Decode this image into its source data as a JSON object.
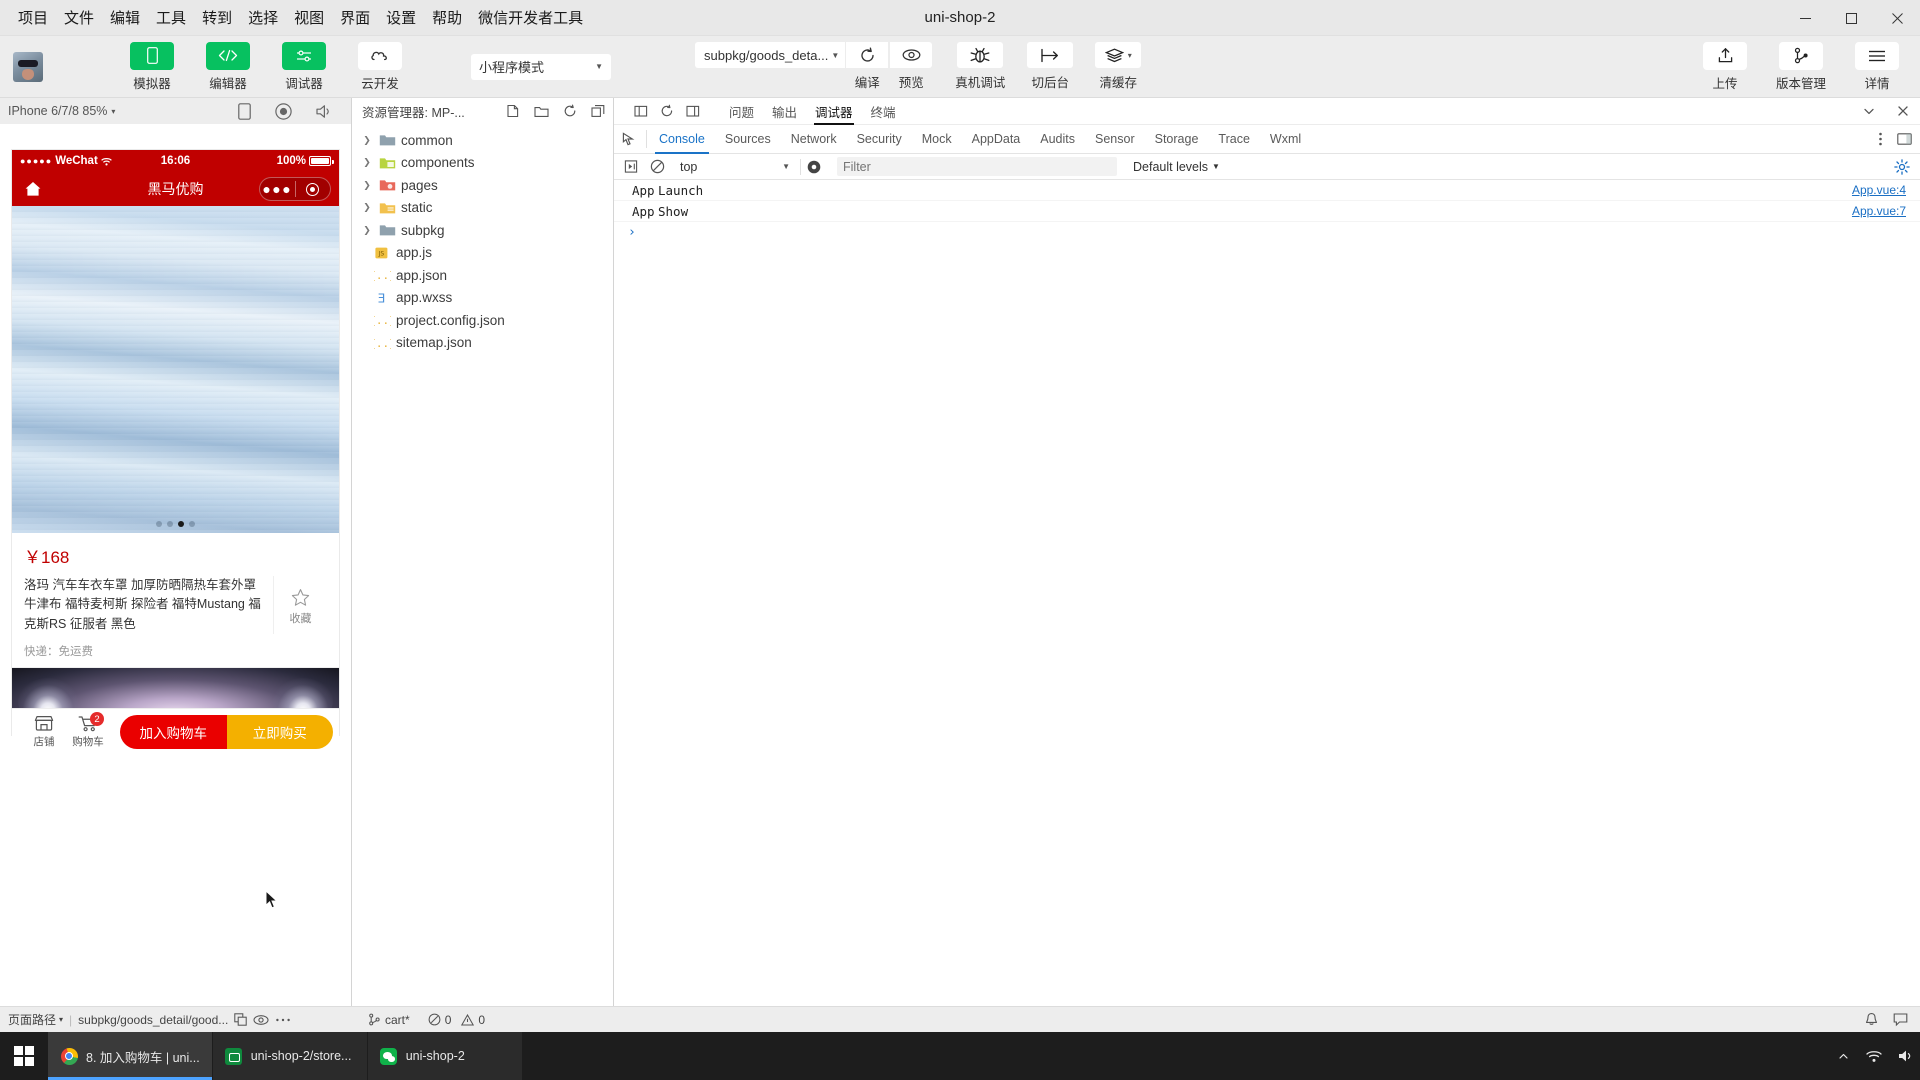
{
  "window": {
    "title": "uni-shop-2",
    "menus": [
      "项目",
      "文件",
      "编辑",
      "工具",
      "转到",
      "选择",
      "视图",
      "界面",
      "设置",
      "帮助",
      "微信开发者工具"
    ],
    "controls": {
      "minimize": "—",
      "maximize": "□",
      "close": "✕"
    }
  },
  "toolbar": {
    "avatar_name": "avatar",
    "main_buttons": [
      {
        "label": "模拟器",
        "icon": "phone-icon",
        "style": "green"
      },
      {
        "label": "编辑器",
        "icon": "code-icon",
        "style": "green"
      },
      {
        "label": "调试器",
        "icon": "debug-sliders-icon",
        "style": "green"
      },
      {
        "label": "云开发",
        "icon": "cloud-icon",
        "style": "white"
      }
    ],
    "mode_select": {
      "value": "小程序模式",
      "caret": "▼"
    },
    "page_select": {
      "value": "subpkg/goods_deta...",
      "caret": "▼"
    },
    "compile_label": "编译",
    "preview_label": "预览",
    "compile_icon": "refresh-icon",
    "preview_icon": "eye-icon",
    "real_debug": {
      "label": "真机调试",
      "icon": "bug-icon"
    },
    "background": {
      "label": "切后台",
      "icon": "background-arrow-icon"
    },
    "clear_cache": {
      "label": "清缓存",
      "icon": "layers-icon",
      "caret": "▾"
    },
    "right_buttons": [
      {
        "label": "上传",
        "icon": "upload-icon"
      },
      {
        "label": "版本管理",
        "icon": "git-branch-icon"
      },
      {
        "label": "详情",
        "icon": "hamburger-icon"
      }
    ]
  },
  "simulator": {
    "device": "IPhone 6/7/8 85%",
    "device_caret": "▾",
    "tools": [
      "rotate-device-icon",
      "record-icon",
      "volume-icon"
    ],
    "status_bar": {
      "dots": "●●●●●",
      "carrier": "WeChat",
      "wifi": "wifi-icon",
      "time": "16:06",
      "battery_pct": "100%"
    },
    "nav": {
      "title": "黑马优购",
      "home_icon": "home-icon",
      "menu_dots": "●●●",
      "target_icon": "target-icon"
    },
    "swiper": {
      "dot_count": 4,
      "active_dot": 3
    },
    "goods": {
      "price": "￥168",
      "name": "洛玛 汽车车衣车罩 加厚防晒隔热车套外罩牛津布 福特麦柯斯 探险者 福特Mustang 福克斯RS 征服者 黑色",
      "fav_label": "收藏",
      "fav_icon": "star-outline-icon",
      "express": "快递：免运费"
    },
    "tabbar": {
      "shop": {
        "label": "店铺",
        "icon": "shop-icon"
      },
      "cart": {
        "label": "购物车",
        "icon": "cart-icon",
        "badge": "2"
      },
      "add_cart": "加入购物车",
      "buy_now": "立即购买"
    }
  },
  "explorer": {
    "title": "资源管理器: MP-...",
    "actions": [
      "new-file-icon",
      "new-folder-icon",
      "refresh-icon",
      "collapse-all-icon"
    ],
    "tree": [
      {
        "name": "common",
        "type": "folder",
        "color": "#8fa1ad",
        "expanded": false
      },
      {
        "name": "components",
        "type": "folder",
        "color": "#b8d43f",
        "expanded": false
      },
      {
        "name": "pages",
        "type": "folder",
        "color": "#e8685a",
        "expanded": false
      },
      {
        "name": "static",
        "type": "folder",
        "color": "#f2c14e",
        "expanded": false
      },
      {
        "name": "subpkg",
        "type": "folder",
        "color": "#8fa1ad",
        "expanded": false
      },
      {
        "name": "app.js",
        "type": "js",
        "color": "#f0c040"
      },
      {
        "name": "app.json",
        "type": "json",
        "color": "#e8b339"
      },
      {
        "name": "app.wxss",
        "type": "wxss",
        "color": "#4a90d9"
      },
      {
        "name": "project.config.json",
        "type": "json",
        "color": "#e8b339"
      },
      {
        "name": "sitemap.json",
        "type": "json",
        "color": "#e8b339"
      }
    ]
  },
  "devtools": {
    "lead_icons": [
      "dock-panel-icon",
      "reload-icon",
      "split-panel-icon"
    ],
    "cn_tabs": [
      {
        "label": "问题",
        "active": false
      },
      {
        "label": "输出",
        "active": false
      },
      {
        "label": "调试器",
        "active": true
      },
      {
        "label": "终端",
        "active": false
      }
    ],
    "top_right_icons": [
      "chevron-down-icon",
      "close-icon"
    ],
    "panel_tabs": [
      {
        "label": "Console",
        "active": true
      },
      {
        "label": "Sources",
        "active": false
      },
      {
        "label": "Network",
        "active": false
      },
      {
        "label": "Security",
        "active": false
      },
      {
        "label": "Mock",
        "active": false
      },
      {
        "label": "AppData",
        "active": false
      },
      {
        "label": "Audits",
        "active": false
      },
      {
        "label": "Sensor",
        "active": false
      },
      {
        "label": "Storage",
        "active": false
      },
      {
        "label": "Trace",
        "active": false
      },
      {
        "label": "Wxml",
        "active": false
      }
    ],
    "panel_right_icons": [
      "more-vertical-icon",
      "dock-side-icon"
    ],
    "filter_row": {
      "execute_icon": "step-into-icon",
      "clear_icon": "no-entry-icon",
      "context": "top",
      "context_caret": "▼",
      "eye_icon": "eye-icon",
      "filter_placeholder": "Filter",
      "filter_value": "",
      "levels": "Default levels",
      "levels_caret": "▼",
      "gear_icon": "gear-icon"
    },
    "logs": [
      {
        "level": "App",
        "message": "Launch",
        "source": "App.vue:4"
      },
      {
        "level": "App",
        "message": "Show",
        "source": "App.vue:7"
      }
    ],
    "prompt": "›"
  },
  "statusbar": {
    "page_path_label": "页面路径",
    "page_path_caret": "▾",
    "page_path": "subpkg/goods_detail/good...",
    "copy_icon": "copy-icon",
    "eye_icon": "eye-icon",
    "more_icon": "ellipsis-icon",
    "git_branch": "cart*",
    "git_icon": "git-branch-icon",
    "errors": "0",
    "warnings": "0",
    "error_icon": "error-circle-icon",
    "warning_icon": "warning-triangle-icon",
    "right_icons": [
      "bell-icon",
      "feedback-icon"
    ]
  },
  "taskbar": {
    "start_icon": "windows-start-icon",
    "items": [
      {
        "name": "8. 加入购物车 | uni...",
        "icon": "chrome-icon",
        "active": true
      },
      {
        "name": "uni-shop-2/store...",
        "icon": "editor-icon",
        "active": false
      },
      {
        "name": "uni-shop-2",
        "icon": "wechat-devtools-icon",
        "active": false
      }
    ],
    "tray": [
      "chevron-up-icon",
      "network-icon",
      "volume-icon"
    ]
  },
  "colors": {
    "brand_green": "#07c160",
    "wechat_red": "#c00000",
    "price_red": "#c00000",
    "cta_red": "#ea0000",
    "cta_orange": "#f4b000",
    "accent_blue": "#1a73c7"
  }
}
